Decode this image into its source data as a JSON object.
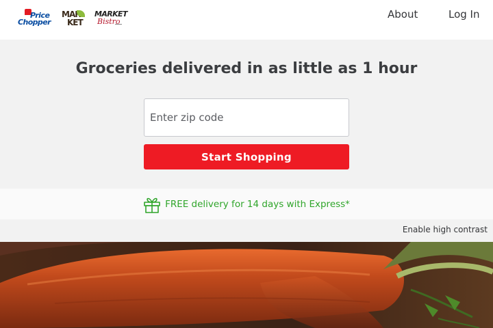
{
  "header": {
    "logos": [
      {
        "name": "Price Chopper",
        "lines": [
          "Price",
          "Chopper"
        ]
      },
      {
        "name": "Market 32",
        "lines": [
          "MAR",
          "KET"
        ]
      },
      {
        "name": "Market Bistro",
        "lines": [
          "MARKET",
          "Bistro"
        ]
      }
    ],
    "nav": {
      "about": "About",
      "login": "Log In"
    }
  },
  "hero": {
    "headline": "Groceries delivered in as little as 1 hour",
    "zip_placeholder": "Enter zip code",
    "zip_value": "",
    "cta": "Start Shopping"
  },
  "promo": {
    "icon": "gift-icon",
    "text": "FREE delivery for 14 days with Express*",
    "color": "#2fa52a"
  },
  "accessibility": {
    "contrast_link": "Enable high contrast"
  },
  "colors": {
    "brand_red": "#ee1b24",
    "promo_green": "#2fa52a",
    "hero_bg": "#f2f2f2"
  },
  "hero_image": {
    "subject": "carrots"
  }
}
